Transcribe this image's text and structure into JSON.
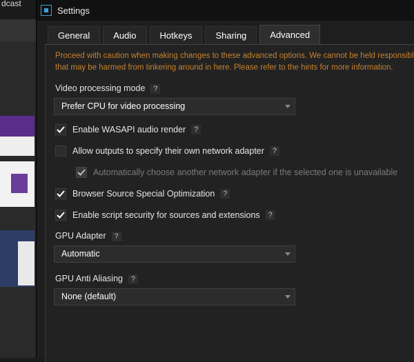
{
  "background": {
    "topbar_text": "dcast"
  },
  "window": {
    "title": "Settings"
  },
  "tabs": [
    {
      "label": "General"
    },
    {
      "label": "Audio"
    },
    {
      "label": "Hotkeys"
    },
    {
      "label": "Sharing"
    },
    {
      "label": "Advanced"
    }
  ],
  "active_tab": "Advanced",
  "warning_lines": [
    "Proceed with caution when making changes to these advanced options. We cannot be held responsible for",
    "that may be harmed from tinkering around in here. Please refer to the hints for more information."
  ],
  "help_glyph": "?",
  "video_processing": {
    "label": "Video processing mode",
    "value": "Prefer CPU for video processing"
  },
  "checkboxes": {
    "wasapi": {
      "label": "Enable WASAPI audio render",
      "checked": true
    },
    "outputs_adapter": {
      "label": "Allow outputs to specify their own network adapter",
      "checked": false
    },
    "auto_adapter": {
      "label": "Automatically choose another network adapter if the selected one is unavailable",
      "checked": true,
      "disabled": true
    },
    "browser_source": {
      "label": "Browser Source Special Optimization",
      "checked": true
    },
    "script_security": {
      "label": "Enable script security for sources and extensions",
      "checked": true
    }
  },
  "gpu_adapter": {
    "label": "GPU Adapter",
    "value": "Automatic"
  },
  "gpu_aa": {
    "label": "GPU Anti Aliasing",
    "value": "None (default)"
  },
  "colors": {
    "warning": "#c7822f",
    "accent": "#3aa0d8"
  }
}
